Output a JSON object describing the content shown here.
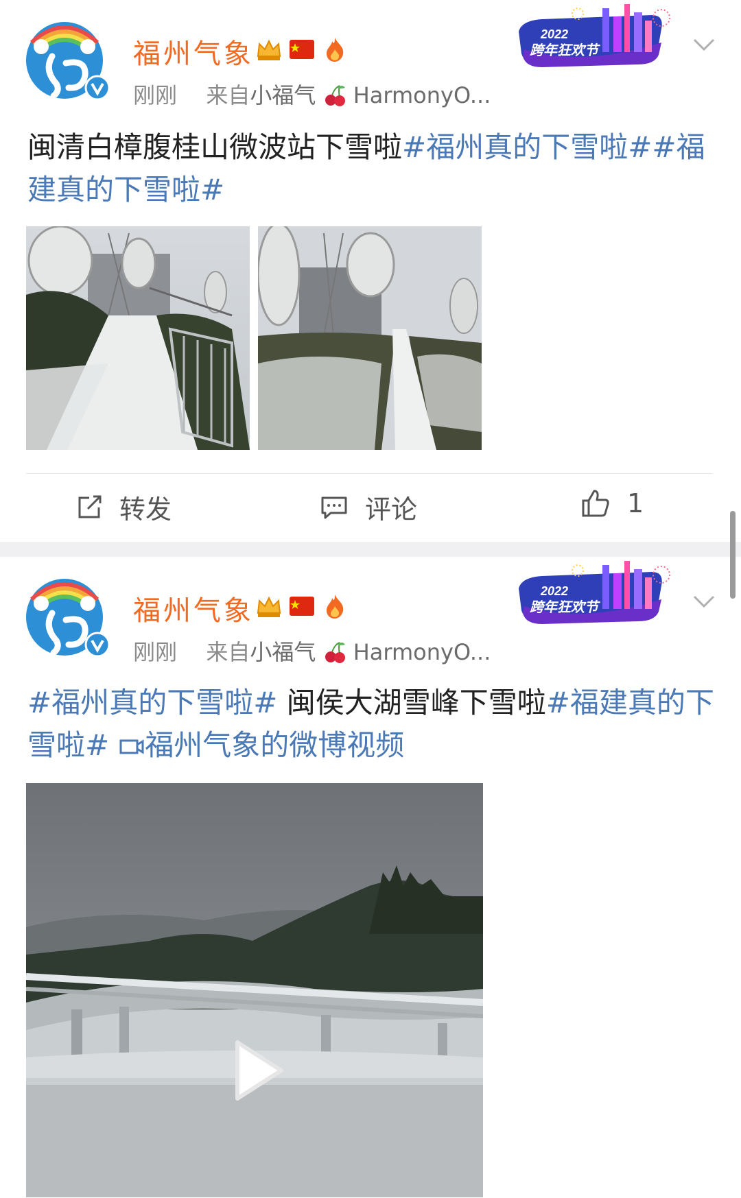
{
  "posts": [
    {
      "author": "福州气象",
      "time": "刚刚",
      "source_prefix": "来自",
      "source_name": "小福气",
      "source_app": "HarmonyO...",
      "banner_year": "2022",
      "banner_text": "跨年狂欢节",
      "text_plain": "闽清白樟腹桂山微波站下雪啦",
      "text_hash_a": "#福州真的下雪啦#",
      "text_hash_b": "#福建真的下雪啦#",
      "photos": [
        "satellite-dishes-snow-path",
        "satellite-dishes-snow-field"
      ],
      "actions": {
        "repost": "转发",
        "comment": "评论",
        "like": "1"
      }
    },
    {
      "author": "福州气象",
      "time": "刚刚",
      "source_prefix": "来自",
      "source_name": "小福气",
      "source_app": "HarmonyO...",
      "banner_year": "2022",
      "banner_text": "跨年狂欢节",
      "text_hash_a": "#福州真的下雪啦#",
      "text_plain": " 闽侯大湖雪峰下雪啦",
      "text_hash_b": "#福建真的下雪啦#",
      "video_link": "福州气象的微博视频"
    }
  ],
  "colors": {
    "author": "#f26a21",
    "hashtag": "#4a79b5",
    "meta": "#8a8a8a",
    "separator": "#f0f0f2"
  }
}
